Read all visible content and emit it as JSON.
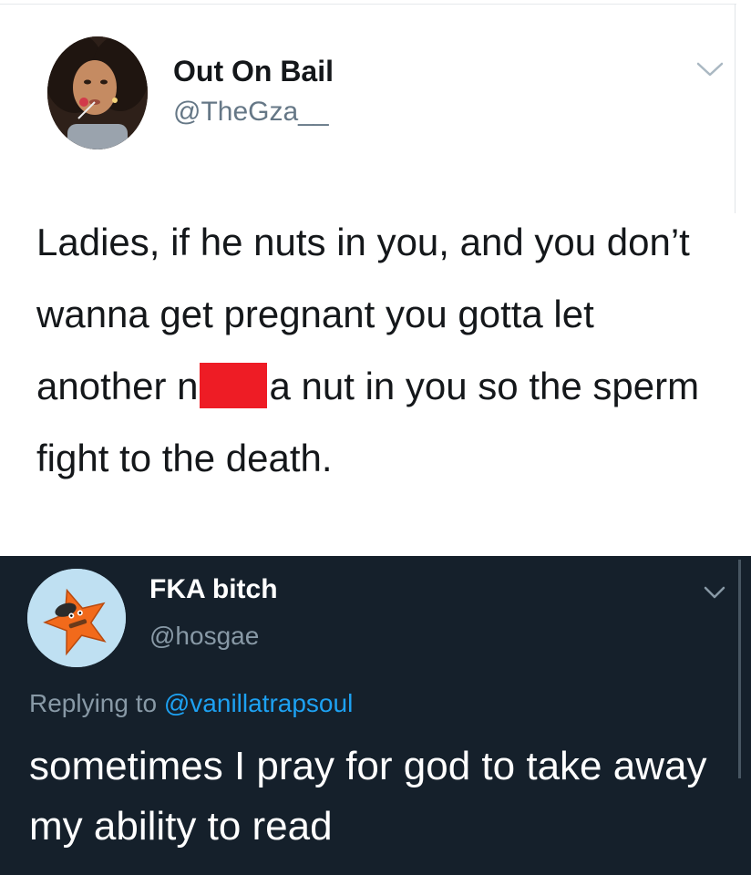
{
  "original_tweet": {
    "author_name": "Out On Bail",
    "handle": "@TheGza__",
    "text_parts": {
      "before_redaction": "Ladies, if he nuts in you, and you don’t wanna get pregnant you gotta let another n",
      "after_redaction": "a nut in you so the sperm fight to the death."
    },
    "menu_icon": "chevron-down-icon",
    "redaction_color": "#ee1c25"
  },
  "reply_tweet": {
    "author_name": "FKA bitch",
    "handle": "@hosgae",
    "replying_prefix": "Replying to",
    "replying_to": "@vanillatrapsoul",
    "text": "sometimes I pray for god to take away my ability to read",
    "menu_icon": "chevron-down-icon"
  },
  "colors": {
    "light_bg": "#ffffff",
    "dark_bg": "#15202b",
    "mention_blue": "#1da1f2",
    "secondary_text": "#8899a6"
  }
}
